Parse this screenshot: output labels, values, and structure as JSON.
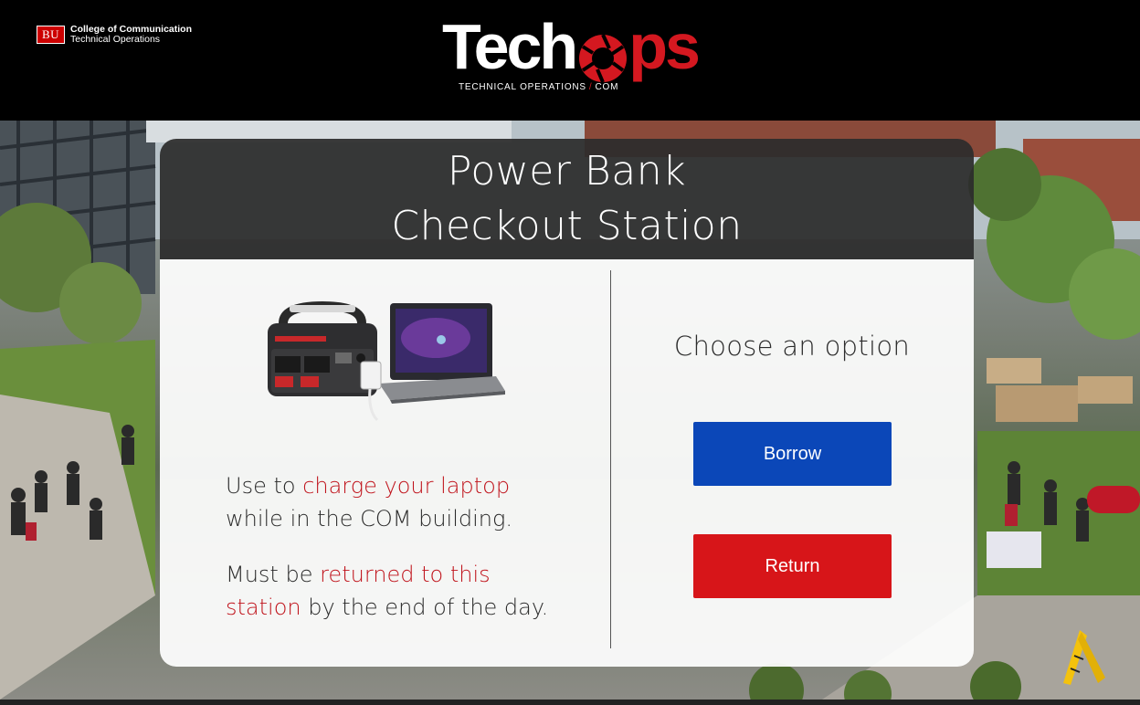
{
  "header": {
    "bu_badge": "BU",
    "bu_line1": "College of Communication",
    "bu_line2": "Technical Operations",
    "logo_part1": "Tech",
    "logo_part2": "ps",
    "logo_tagline_a": "TECHNICAL OPERATIONS",
    "logo_tagline_sep": "/",
    "logo_tagline_b": "COM"
  },
  "card": {
    "title_line1": "Power Bank",
    "title_line2": "Checkout Station",
    "desc1": {
      "pre": "Use to ",
      "highlight": "charge your laptop",
      "post": "while in the COM building."
    },
    "desc2": {
      "pre": "Must be ",
      "highlight1": "returned to this",
      "highlight2": "station",
      "post": " by the end of the day."
    },
    "choose_label": "Choose an option",
    "borrow_label": "Borrow",
    "return_label": "Return"
  },
  "colors": {
    "borrow": "#0b47b8",
    "return": "#d71519",
    "highlight": "#c0141c",
    "brand_red": "#d41820"
  },
  "icons": {
    "logo_o": "camera-aperture-icon",
    "product": "power-bank-and-laptop-image"
  }
}
